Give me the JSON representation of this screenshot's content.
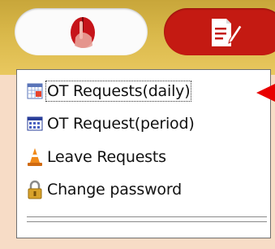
{
  "nav": {
    "left_icon": "mouse-hand-icon",
    "right_icon": "document-edit-icon"
  },
  "menu": {
    "items": [
      {
        "label": "OT Requests(daily)",
        "icon": "calendar-daily-icon"
      },
      {
        "label": "OT Request(period)",
        "icon": "calendar-period-icon"
      },
      {
        "label": "Leave Requests",
        "icon": "traffic-cone-icon"
      },
      {
        "label": "Change password",
        "icon": "padlock-icon"
      }
    ]
  },
  "colors": {
    "accent_red": "#c41a12",
    "arrow_red": "#e80000",
    "bar_gold": "#d9b84a"
  }
}
